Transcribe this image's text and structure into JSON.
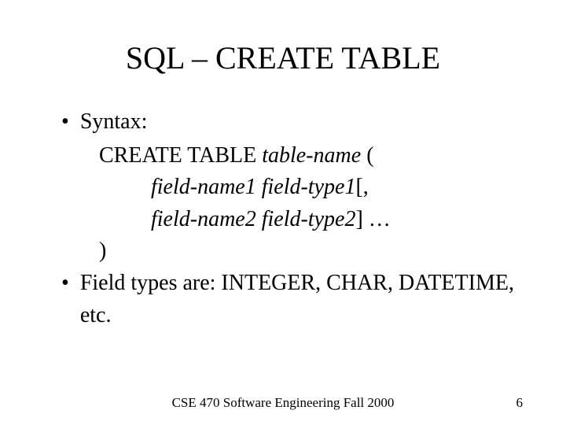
{
  "title": "SQL – CREATE TABLE",
  "bullet1_label": "Syntax:",
  "syntax_line1_plain": "CREATE TABLE ",
  "syntax_line1_italic": "table-name",
  "syntax_line1_tail": " (",
  "syntax_line2_italic": "field-name1  field-type1",
  "syntax_line2_tail": "[,",
  "syntax_line3_italic": "field-name2  field-type2",
  "syntax_line3_tail": "] …",
  "syntax_close": ")",
  "bullet2_text": "Field types are: INTEGER, CHAR, DATETIME, etc.",
  "footer": "CSE 470    Software Engineering    Fall 2000",
  "page_number": "6"
}
